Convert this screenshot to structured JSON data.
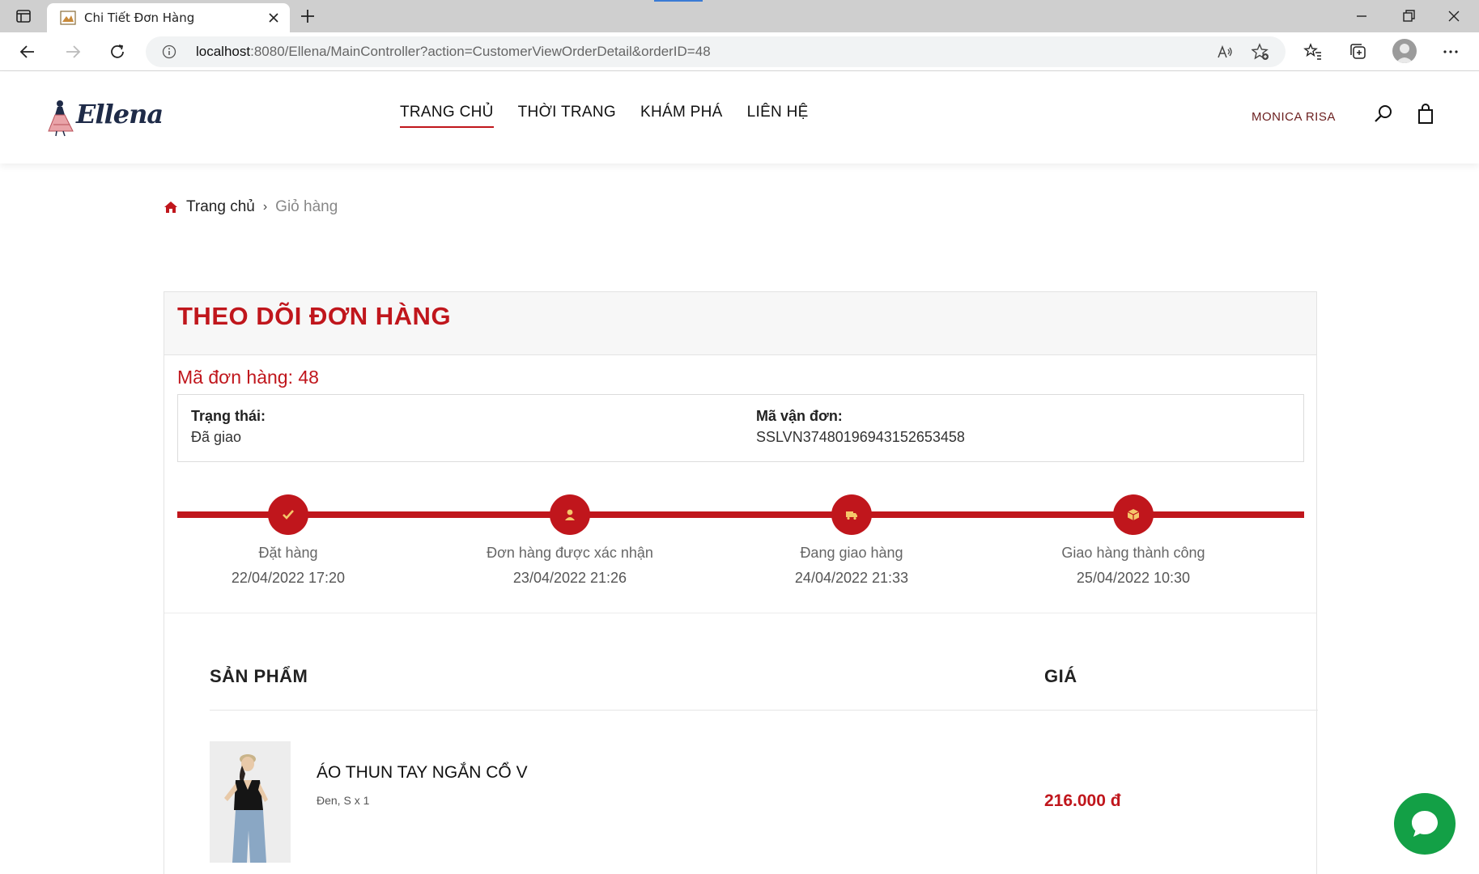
{
  "browser": {
    "tab_title": "Chi Tiết Đơn Hàng",
    "url_host": "localhost",
    "url_rest": ":8080/Ellena/MainController?action=CustomerViewOrderDetail&orderID=48"
  },
  "site": {
    "logo_text": "Ellena",
    "nav": {
      "home": "TRANG CHỦ",
      "fashion": "THỜI TRANG",
      "explore": "KHÁM PHÁ",
      "contact": "LIÊN HỆ"
    },
    "user_name": "MONICA RISA"
  },
  "breadcrumb": {
    "home": "Trang chủ",
    "current": "Giỏ hàng"
  },
  "order": {
    "title": "THEO DÕI ĐƠN HÀNG",
    "id_text": "Mã đơn hàng: 48",
    "status_label": "Trạng thái:",
    "status_value": "Đã giao",
    "tracking_label": "Mã vận đơn:",
    "tracking_value": "SSLVN37480196943152653458",
    "steps": [
      {
        "label": "Đặt hàng",
        "date": "22/04/2022 17:20",
        "icon": "check-icon"
      },
      {
        "label": "Đơn hàng được xác nhận",
        "date": "23/04/2022 21:26",
        "icon": "user-icon"
      },
      {
        "label": "Đang giao hàng",
        "date": "24/04/2022 21:33",
        "icon": "truck-icon"
      },
      {
        "label": "Giao hàng thành công",
        "date": "25/04/2022 10:30",
        "icon": "box-icon"
      }
    ],
    "columns": {
      "product": "SẢN PHẨM",
      "price": "GIÁ"
    },
    "items": [
      {
        "name": "ÁO THUN TAY NGẮN CỔ V",
        "variant": "Đen, S x 1",
        "price": "216.000 đ"
      }
    ]
  },
  "colors": {
    "accent": "#c0161c",
    "chat": "#13a046"
  }
}
